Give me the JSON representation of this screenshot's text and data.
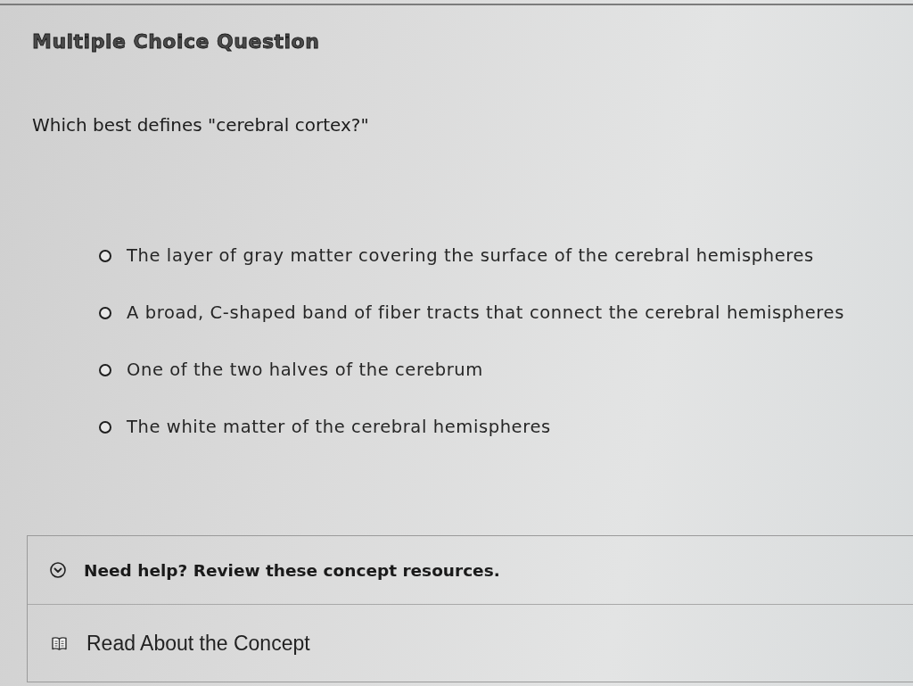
{
  "header": {
    "title": "Multiple Choice Question"
  },
  "question": {
    "prompt": "Which best defines \"cerebral cortex?\""
  },
  "options": [
    {
      "label": "The layer of gray matter covering the surface of the cerebral hemispheres",
      "selected": false
    },
    {
      "label": "A broad, C-shaped band of fiber tracts that connect the cerebral hemispheres",
      "selected": false
    },
    {
      "label": "One of the two halves of the cerebrum",
      "selected": false
    },
    {
      "label": "The white matter of the cerebral hemispheres",
      "selected": false
    }
  ],
  "help": {
    "toggle": {
      "label": "Need help? Review these concept resources.",
      "expanded": true
    },
    "resources": [
      {
        "label": "Read About the Concept"
      }
    ]
  }
}
